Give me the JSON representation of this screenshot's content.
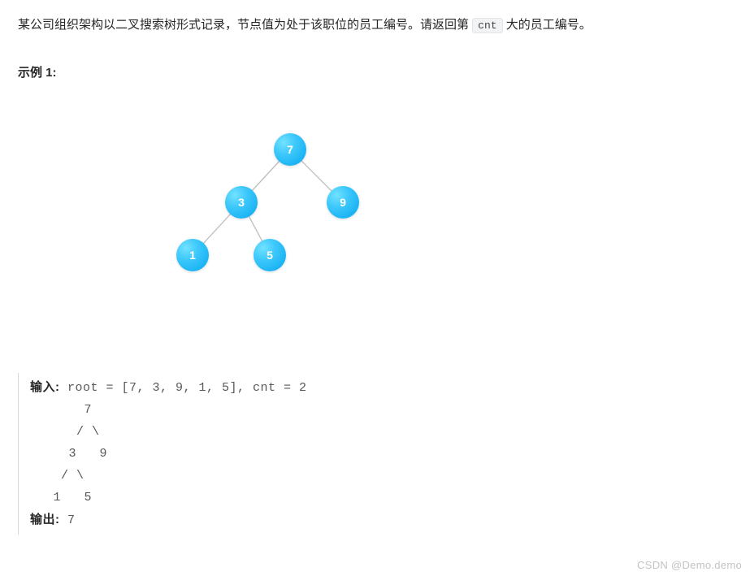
{
  "description": {
    "part1": "某公司组织架构以二叉搜索树形式记录，节点值为处于该职位的员工编号。请返回第 ",
    "code": "cnt",
    "part2": " 大的员工编号。"
  },
  "example_label": "示例 1:",
  "tree": {
    "n7": "7",
    "n3": "3",
    "n9": "9",
    "n1": "1",
    "n5": "5"
  },
  "io": {
    "input_label": "输入:",
    "input_text": " root = [7, 3, 9, 1, 5], cnt = 2",
    "tree_line1": "       7",
    "tree_line2": "      / \\",
    "tree_line3": "     3   9",
    "tree_line4": "    / \\",
    "tree_line5": "   1   5",
    "output_label": "输出:",
    "output_text": " 7"
  },
  "watermark": "CSDN @Demo.demo"
}
